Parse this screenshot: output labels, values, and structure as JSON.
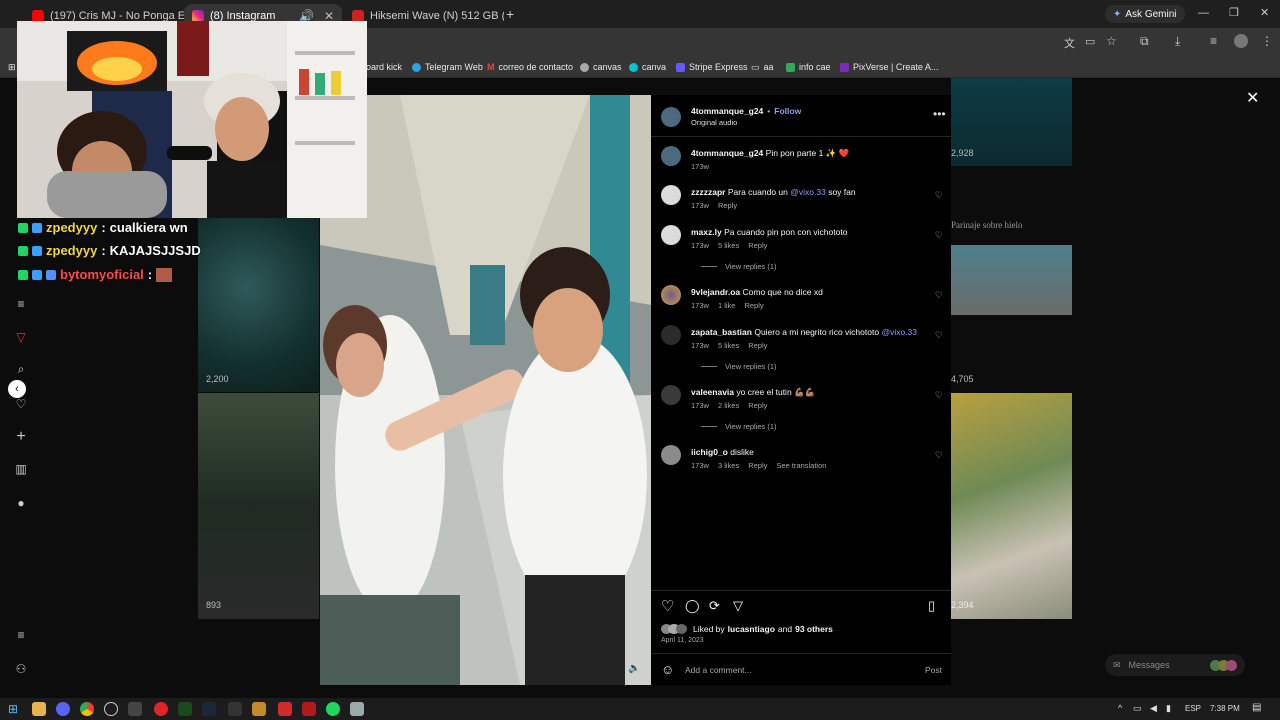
{
  "tabs": [
    {
      "title": "(197) Cris MJ - No Ponga Excus",
      "color": "#ff0000"
    },
    {
      "title": "(8) Instagram",
      "color": "#d62976"
    },
    {
      "title": "Hiksemi Wave (N) 512 GB (HS-",
      "color": "#cc2222"
    }
  ],
  "toolbar": {
    "ask_gemini": "Ask Gemini"
  },
  "bookmarks": [
    "oard kick",
    "Telegram Web",
    "correo de contacto",
    "canvas",
    "canva",
    "Stripe Express",
    "aa",
    "info cae",
    "PixVerse | Create A..."
  ],
  "chat": [
    {
      "user": "zpedyyy",
      "message": "cualkiera wn",
      "color": "#f5d83a"
    },
    {
      "user": "zpedyyy",
      "message": "KAJAJSJJSJD",
      "color": "#f5d83a"
    },
    {
      "user": "bytomyoficial",
      "message": "",
      "color": "#ff4b4b"
    }
  ],
  "grid": {
    "counts": [
      "2,928",
      "2,200",
      "4,705",
      "893",
      "2,394"
    ],
    "caption_right": "Parinaje sobre hielo"
  },
  "post": {
    "author": "4tommanque_g24",
    "follow": "Follow",
    "audio": "Original audio",
    "caption_user": "4tommanque_g24",
    "caption_text": "Pin pon parte 1 ✨ ❤️",
    "caption_time": "173w",
    "comments": [
      {
        "user": "zzzzzapr",
        "text": "Para cuando un",
        "mention": "@vixo.33",
        "after": "soy fan",
        "time": "173w",
        "likes": "",
        "reply": "Reply",
        "view_replies": ""
      },
      {
        "user": "maxz.ly",
        "text": "Pa cuando pin pon con vichototo",
        "mention": "",
        "after": "",
        "time": "173w",
        "likes": "5 likes",
        "reply": "Reply",
        "view_replies": "View replies (1)"
      },
      {
        "user": "9vlejandr.oa",
        "text": "Como que no dice xd",
        "mention": "",
        "after": "",
        "time": "173w",
        "likes": "1 like",
        "reply": "Reply",
        "view_replies": ""
      },
      {
        "user": "zapata_bastian",
        "text": "Quiero a mi negrito rico vichototo",
        "mention": "@vixo.33",
        "after": "",
        "time": "173w",
        "likes": "5 likes",
        "reply": "Reply",
        "view_replies": "View replies (1)"
      },
      {
        "user": "valeenavia",
        "text": "yo cree el tutin 💪🏽💪🏽",
        "mention": "",
        "after": "",
        "time": "173w",
        "likes": "2 likes",
        "reply": "Reply",
        "view_replies": "View replies (1)"
      },
      {
        "user": "iichig0_o",
        "text": "dislike",
        "mention": "",
        "after": "",
        "time": "173w",
        "likes": "3 likes",
        "reply": "Reply",
        "view_replies": "",
        "translate": "See translation"
      }
    ],
    "liked_by_prefix": "Liked by",
    "liked_by_user": "lucasntiago",
    "liked_by_and": "and",
    "liked_by_others": "93 others",
    "date": "April 11, 2023",
    "add_comment": "Add a comment...",
    "post_button": "Post"
  },
  "messages_label": "Messages",
  "taskbar": {
    "lang": "ESP",
    "time": "7:38 PM"
  },
  "colors": {
    "link": "#8f9dff",
    "accent": "#0095f6"
  }
}
